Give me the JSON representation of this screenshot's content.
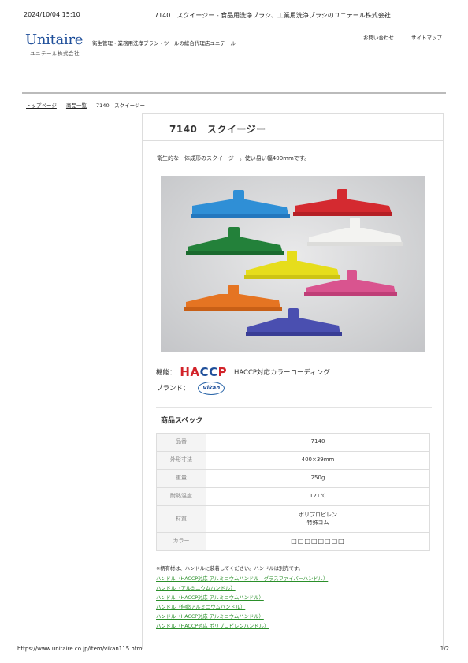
{
  "print_header": {
    "date": "2024/10/04 15:10",
    "title": "7140　スクイージー - 食品用洗浄ブラシ、工業用洗浄ブラシのユニテール株式会社"
  },
  "site": {
    "logo": "Unitaire",
    "logo_sub": "ユニテール株式会社",
    "tagline": "衛生管理・業務用洗浄ブラシ・ツールの総合代理店ユニテール",
    "links": [
      "お問い合わせ",
      "サイトマップ"
    ]
  },
  "breadcrumb": [
    "トップページ",
    "商品一覧",
    "7140　スクイージー"
  ],
  "product": {
    "title": "7140　スクイージー",
    "description": "衛生的な一体成形のスクイージー。使い易い幅400mmです。",
    "function_label": "機能：",
    "haccp_logo": [
      "HA",
      "CC",
      "P"
    ],
    "haccp_text": "HACCP対応カラーコーディング",
    "brand_label": "ブランド：",
    "brand_logo": "Vikan"
  },
  "spec": {
    "heading": "商品スペック",
    "rows": [
      {
        "key": "品番",
        "value": "7140"
      },
      {
        "key": "外形寸法",
        "value": "400×39mm"
      },
      {
        "key": "重量",
        "value": "250g"
      },
      {
        "key": "耐熱温度",
        "value": "121℃"
      },
      {
        "key": "材質",
        "value": "ポリプロピレン",
        "value2": "特殊ゴム"
      },
      {
        "key": "カラー",
        "value": "□□□□□□□□"
      }
    ]
  },
  "note": "※柄有材は、ハンドルに装着してください。ハンドルは別売です。",
  "handle_links": [
    "ハンドル（HACCP対応 アルミニウムハンドル　グラスファイバーハンドル）",
    "ハンドル（アルミニウムハンドル）",
    "ハンドル（HACCP対応 アルミニウムハンドル）",
    "ハンドル（伸縮アルミニウムハンドル）",
    "ハンドル（HACCP対応 アルミニウムハンドル）",
    "ハンドル（HACCP対応 ポリプロピレンハンドル）"
  ],
  "photo_colors": {
    "blue": "#2f8fd6",
    "red": "#d42a30",
    "green": "#23813a",
    "white": "#f3f3f1",
    "yellow": "#e6dd1c",
    "pink": "#d9548f",
    "orange": "#e57422",
    "purple": "#4a4fb0"
  },
  "print_footer": {
    "url": "https://www.unitaire.co.jp/item/vikan115.html",
    "page": "1/2"
  }
}
